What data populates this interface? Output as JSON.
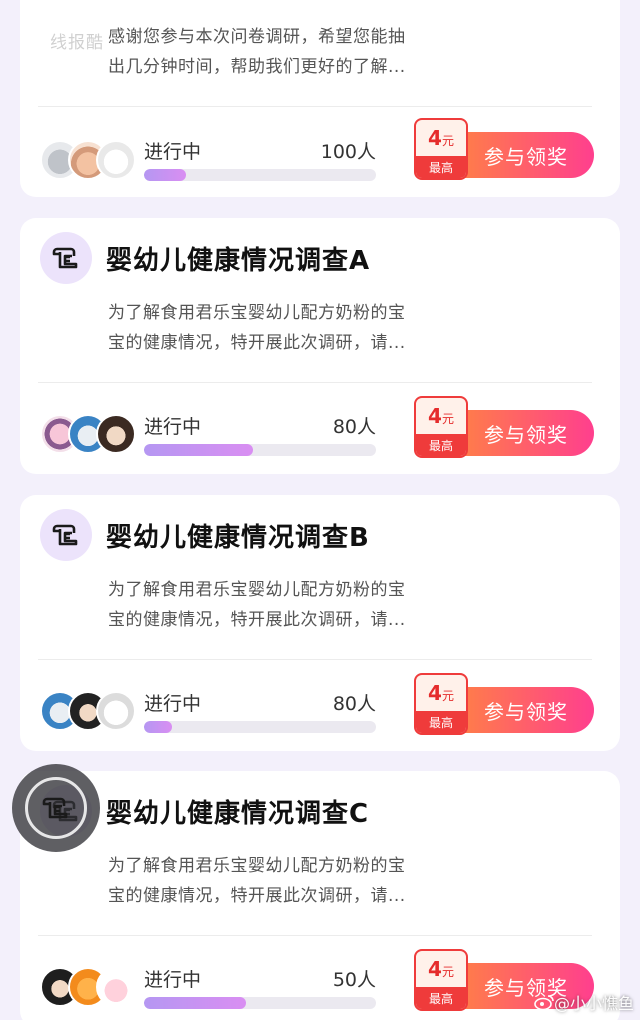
{
  "watermark_text": "线报酷",
  "weibo_watermark": "@小小憔鱼",
  "cards": [
    {
      "title": "",
      "desc_line1": "感谢您参与本次问卷调研，希望您能抽",
      "desc_line2": "出几分钟时间，帮助我们更好的了解...",
      "status": "进行中",
      "count": "100人",
      "progress": 0.18,
      "max_amount": "4",
      "max_unit": "元",
      "max_label": "最高",
      "button_label": "参与领奖"
    },
    {
      "title": "婴幼儿健康情况调查A",
      "desc_line1": "为了解食用君乐宝婴幼儿配方奶粉的宝",
      "desc_line2": "宝的健康情况，特开展此次调研，请...",
      "status": "进行中",
      "count": "80人",
      "progress": 0.47,
      "max_amount": "4",
      "max_unit": "元",
      "max_label": "最高",
      "button_label": "参与领奖"
    },
    {
      "title": "婴幼儿健康情况调查B",
      "desc_line1": "为了解食用君乐宝婴幼儿配方奶粉的宝",
      "desc_line2": "宝的健康情况，特开展此次调研，请...",
      "status": "进行中",
      "count": "80人",
      "progress": 0.12,
      "max_amount": "4",
      "max_unit": "元",
      "max_label": "最高",
      "button_label": "参与领奖"
    },
    {
      "title": "婴幼儿健康情况调查C",
      "desc_line1": "为了解食用君乐宝婴幼儿配方奶粉的宝",
      "desc_line2": "宝的健康情况，特开展此次调研，请...",
      "status": "进行中",
      "count": "50人",
      "progress": 0.44,
      "max_amount": "4",
      "max_unit": "元",
      "max_label": "最高",
      "button_label": "参与领奖"
    }
  ],
  "colors": {
    "background": "#f3f0fb",
    "icon_bg": "#ece3fb",
    "icon_stroke": "#1a1a1a",
    "progress_fill_start": "#b597f2",
    "progress_fill_end": "#d98ef2",
    "button_start": "#ff8a3b",
    "button_end": "#ff3f8e",
    "badge_red": "#ef3b3b"
  },
  "icons": {
    "survey_icon": "scroll-document-icon",
    "floating_ball_icon": "scroll-document-icon"
  }
}
